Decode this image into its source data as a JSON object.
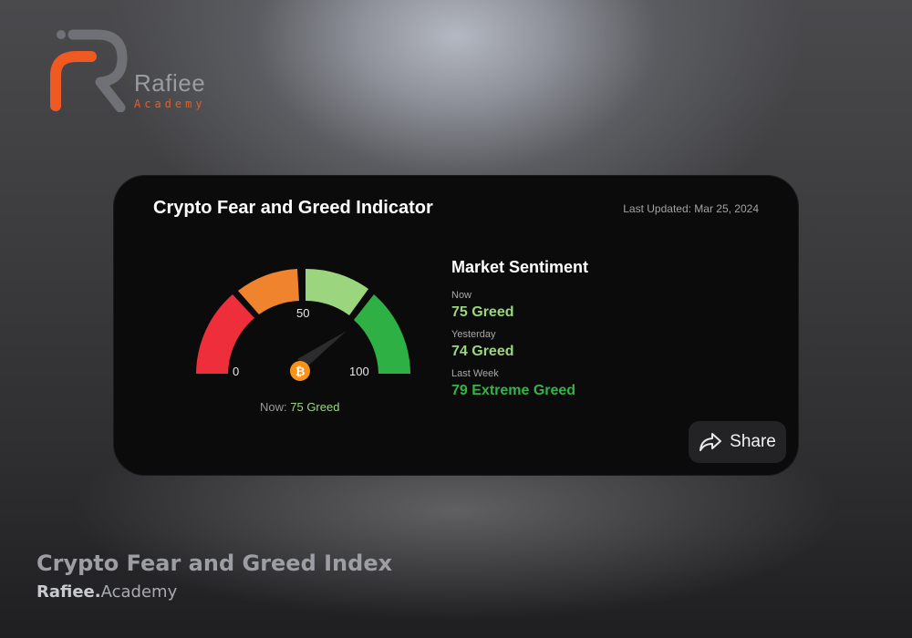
{
  "logo": {
    "name": "Rafiee",
    "sub": "Academy"
  },
  "card": {
    "title": "Crypto Fear and Greed Indicator",
    "last_updated": "Last Updated: Mar 25, 2024",
    "gauge": {
      "min_label": "0",
      "mid_label": "50",
      "max_label": "100",
      "value": 75,
      "now_prefix": "Now:",
      "now_value": "75 Greed"
    },
    "sentiment": {
      "title": "Market Sentiment",
      "rows": [
        {
          "label": "Now",
          "value": "75 Greed"
        },
        {
          "label": "Yesterday",
          "value": "74 Greed"
        },
        {
          "label": "Last Week",
          "value": "79 Extreme Greed"
        }
      ]
    },
    "share_label": "Share"
  },
  "footer": {
    "title": "Crypto Fear and Greed Index",
    "brand_bold": "Rafiee.",
    "brand_rest": "Academy"
  },
  "colors": {
    "extreme_fear": "#ee2e3a",
    "fear": "#f0832e",
    "greed": "#9bd67f",
    "extreme_greed": "#2fb045",
    "accent": "#f05a22"
  }
}
